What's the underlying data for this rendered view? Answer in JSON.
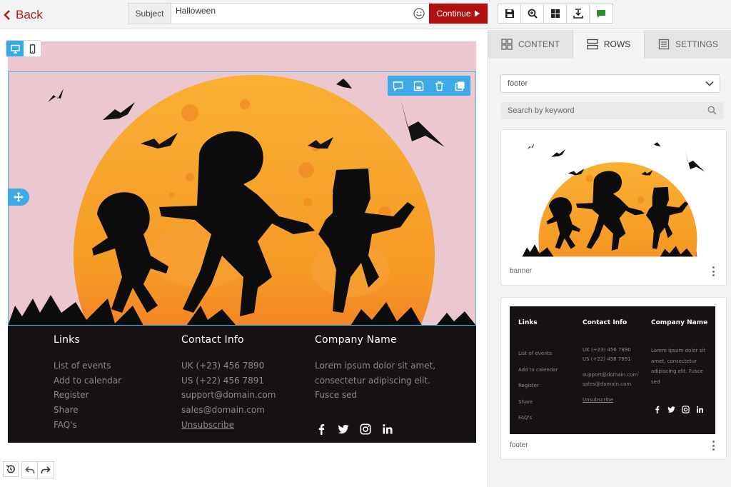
{
  "topbar": {
    "back_label": "Back",
    "subject_label": "Subject",
    "subject_value": "Halloween",
    "continue_label": "Continue"
  },
  "footer": {
    "links": {
      "heading": "Links",
      "items": [
        "List of events",
        "Add to calendar",
        "Register",
        "Share",
        "FAQ's"
      ]
    },
    "contact": {
      "heading": "Contact Info",
      "items": [
        "UK (+23) 456 7890",
        "US (+22) 456 7891",
        "support@domain.com",
        "sales@domain.com"
      ],
      "unsubscribe": "Unsubscribe"
    },
    "company": {
      "heading": "Company Name",
      "lines": [
        "Lorem ipsum dolor sit amet,",
        "consectetur adipiscing elit.",
        "Fusce sed"
      ]
    }
  },
  "sidebar": {
    "tabs": [
      {
        "label": "CONTENT",
        "icon": "grid-icon"
      },
      {
        "label": "ROWS",
        "icon": "rows-icon"
      },
      {
        "label": "SETTINGS",
        "icon": "settings-icon"
      }
    ],
    "active_tab": "ROWS",
    "dropdown_value": "footer",
    "search_placeholder": "Search by keyword",
    "cards": [
      {
        "label": "banner"
      },
      {
        "label": "footer"
      }
    ],
    "mini_footer": {
      "links_heading": "Links",
      "links_items": [
        "List of events",
        "Add to calendar",
        "Register",
        "Share",
        "FAQ's"
      ],
      "contact_heading": "Contact Info",
      "contact_items": [
        "UK (+23) 456 7890",
        "US (+22) 456 7891",
        "support@domain.com",
        "sales@domain.com"
      ],
      "contact_unsubscribe": "Unsubscribe",
      "company_heading": "Company Name",
      "company_lines": [
        "Lorem ipsum dolor sit",
        "amet, consectetur",
        "adipiscing elit. Fusce",
        "sed"
      ]
    }
  },
  "colors": {
    "brand_red": "#b01010",
    "selection_blue": "#3fa9e8",
    "banner_pink": "#ebc8d0",
    "footer_dark": "#161216",
    "moon_orange": "#f7a02a"
  }
}
